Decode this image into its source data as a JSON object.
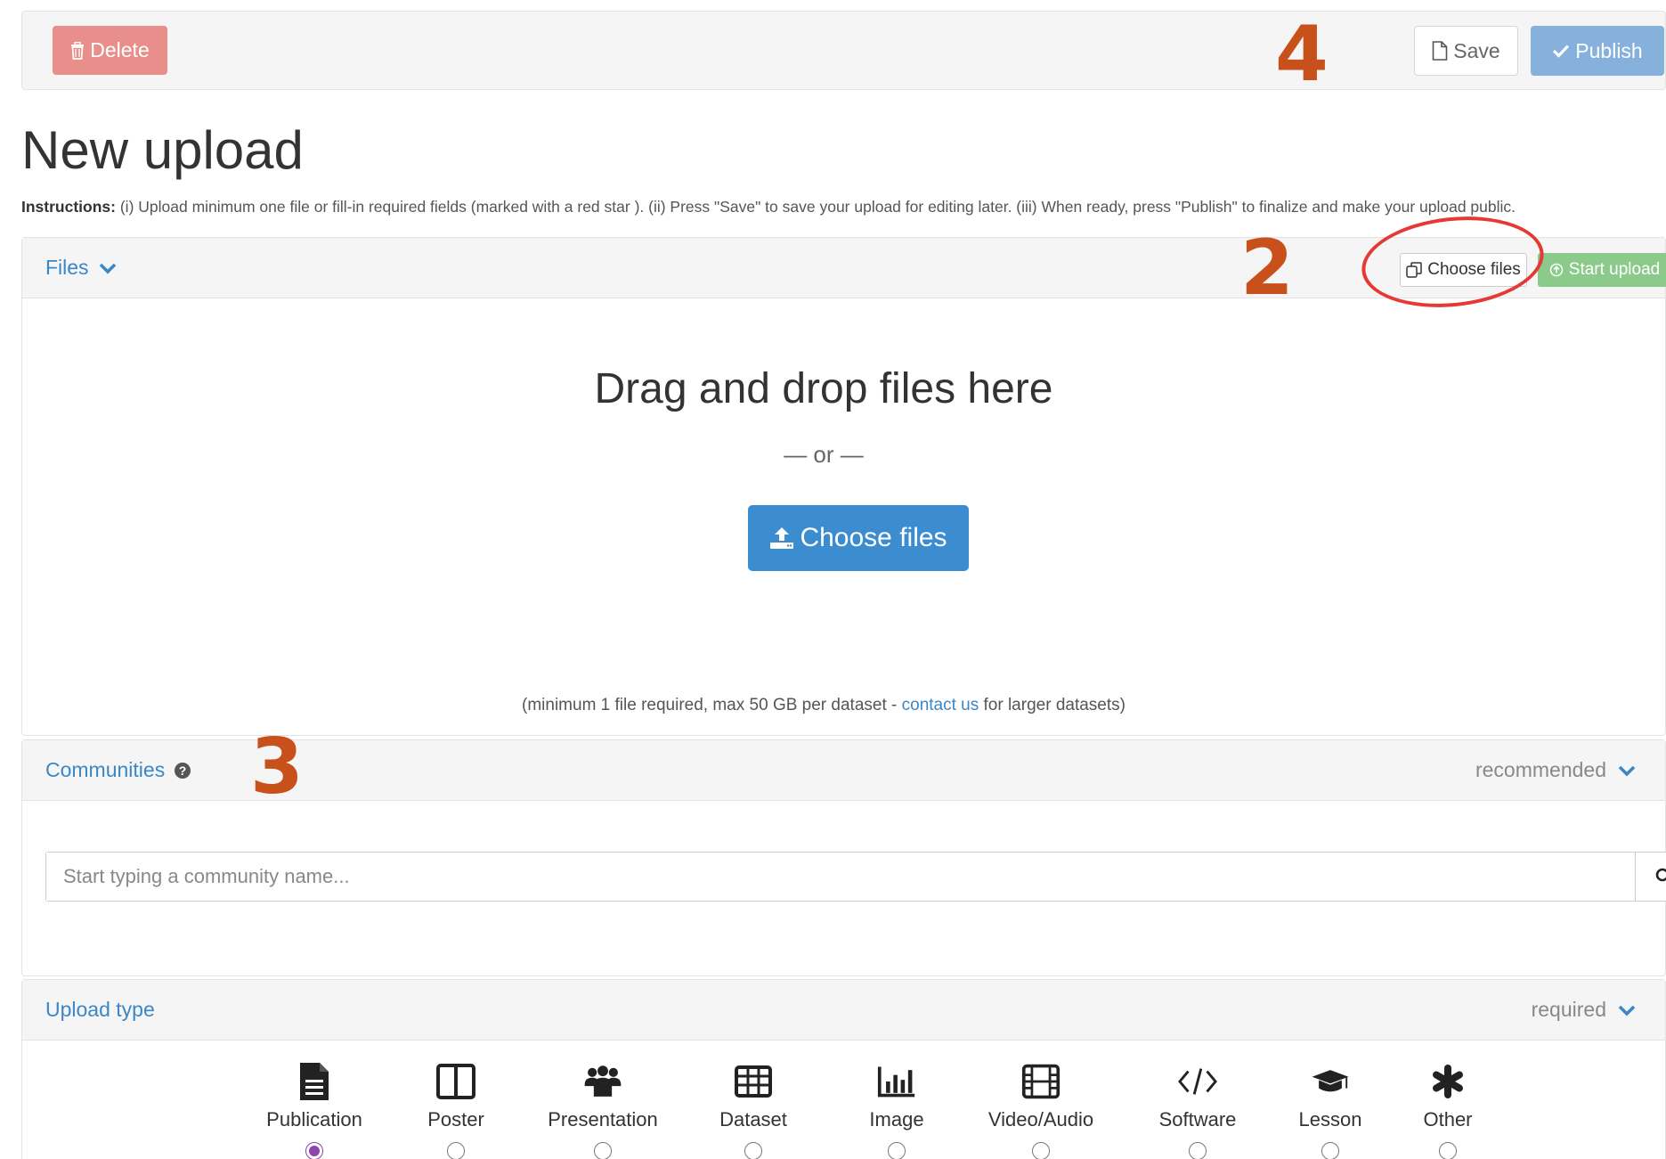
{
  "toolbar": {
    "delete_label": "Delete",
    "save_label": "Save",
    "publish_label": "Publish"
  },
  "annotations": {
    "step2": "2",
    "step3": "3",
    "step4": "4"
  },
  "page": {
    "title": "New upload",
    "instructions_label": "Instructions:",
    "instructions_text": "(i) Upload minimum one file or fill-in required fields (marked with a red star ). (ii) Press \"Save\" to save your upload for editing later. (iii) When ready, press \"Publish\" to finalize and make your upload public."
  },
  "files": {
    "header": "Files",
    "choose_files_label": "Choose files",
    "start_upload_label": "Start upload",
    "drop_title": "Drag and drop files here",
    "or_text": "— or —",
    "choose_files_big_label": "Choose files",
    "note_prefix": "(minimum 1 file required, max 50 GB per dataset - ",
    "note_link": "contact us",
    "note_suffix": " for larger datasets)"
  },
  "communities": {
    "header": "Communities",
    "status": "recommended",
    "search_placeholder": "Start typing a community name..."
  },
  "upload_type": {
    "header": "Upload type",
    "status": "required",
    "selected": "Publication",
    "types": [
      {
        "label": "Publication",
        "icon": "publication-icon"
      },
      {
        "label": "Poster",
        "icon": "poster-icon"
      },
      {
        "label": "Presentation",
        "icon": "presentation-icon"
      },
      {
        "label": "Dataset",
        "icon": "dataset-icon"
      },
      {
        "label": "Image",
        "icon": "image-icon"
      },
      {
        "label": "Video/Audio",
        "icon": "video-audio-icon"
      },
      {
        "label": "Software",
        "icon": "software-icon"
      },
      {
        "label": "Lesson",
        "icon": "lesson-icon"
      },
      {
        "label": "Other",
        "icon": "other-icon"
      }
    ]
  },
  "colors": {
    "link": "#3a87c8",
    "primary": "#3c8dd0",
    "danger": "#e88e8b",
    "success": "#8cca8c",
    "annotation": "#c8511b",
    "selected_radio": "#8e44ad"
  }
}
